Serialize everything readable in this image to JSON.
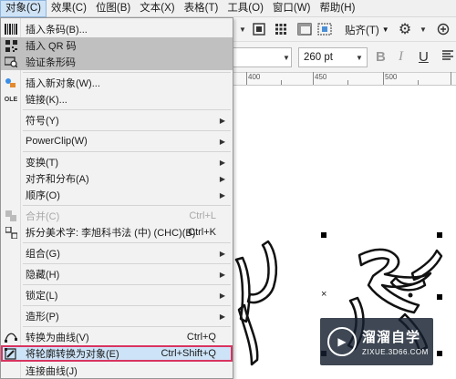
{
  "menubar": {
    "items": [
      "对象(C)",
      "效果(C)",
      "位图(B)",
      "文本(X)",
      "表格(T)",
      "工具(O)",
      "窗口(W)",
      "帮助(H)"
    ]
  },
  "toolbar": {
    "snap_label": "贴齐(T)",
    "font_size": "260 pt",
    "bold": "B",
    "italic": "I",
    "underline": "U"
  },
  "ruler": {
    "labels": [
      "400",
      "450",
      "500"
    ]
  },
  "menu": {
    "insert_barcode": "插入条码(B)...",
    "insert_qr": "插入 QR 码",
    "validate_barcode": "验证条形码",
    "insert_new_object": "插入新对象(W)...",
    "link": "链接(K)...",
    "symbol": "符号(Y)",
    "powerclip": "PowerClip(W)",
    "transform": "变换(T)",
    "align_distribute": "对齐和分布(A)",
    "order": "顺序(O)",
    "combine": "合并(C)",
    "combine_shortcut": "Ctrl+L",
    "break_apart": "拆分美术字: 李旭科书法 (中) (CHC)(B)",
    "break_apart_shortcut": "Ctrl+K",
    "group": "组合(G)",
    "hide": "隐藏(H)",
    "lock": "锁定(L)",
    "shaping": "造形(P)",
    "convert_to_curves": "转换为曲线(V)",
    "convert_to_curves_shortcut": "Ctrl+Q",
    "convert_outline": "将轮廓转换为对象(E)",
    "convert_outline_shortcut": "Ctrl+Shift+Q",
    "join_curves": "连接曲线(J)"
  },
  "watermark": {
    "title": "溜溜自学",
    "subtitle": "ZIXUE.3D66.COM"
  },
  "colors": {
    "highlight_border": "#d8345f",
    "menu_highlight": "#c0c0c0",
    "active_menu": "#cfe3f6"
  }
}
